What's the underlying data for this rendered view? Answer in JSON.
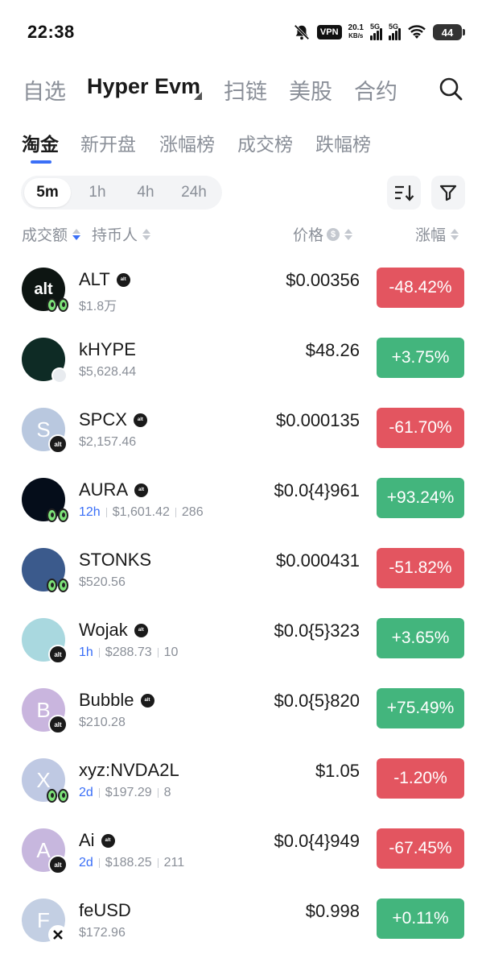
{
  "status_bar": {
    "time": "22:38",
    "vpn": "VPN",
    "net_speed_value": "20.1",
    "net_speed_unit": "KB/s",
    "signal1_label": "5G",
    "signal2_label": "5G",
    "battery": "44"
  },
  "top_nav": {
    "items": [
      "自选",
      "Hyper Evm",
      "扫链",
      "美股",
      "合约"
    ],
    "active_index": 1
  },
  "sub_tabs": {
    "items": [
      "淘金",
      "新开盘",
      "涨幅榜",
      "成交榜",
      "跌幅榜"
    ],
    "active_index": 0
  },
  "time_filter": {
    "options": [
      "5m",
      "1h",
      "4h",
      "24h"
    ],
    "selected": "5m"
  },
  "columns": {
    "volume": "成交额",
    "holders": "持币人",
    "price": "价格",
    "price_unit": "$",
    "change": "涨幅"
  },
  "tokens": [
    {
      "name": "ALT",
      "verified": true,
      "sub": "$1.8万",
      "age": "",
      "holders": "",
      "price": "$0.00356",
      "change": "-48.42%",
      "dir": "down",
      "avatar_letter": "alt",
      "avatar_color": "#0d1512",
      "badge": "eyes"
    },
    {
      "name": "kHYPE",
      "verified": false,
      "sub": "$5,628.44",
      "age": "",
      "holders": "",
      "price": "$48.26",
      "change": "+3.75%",
      "dir": "up",
      "avatar_letter": "",
      "avatar_color": "#0e2b25",
      "badge": "grey"
    },
    {
      "name": "SPCX",
      "verified": true,
      "sub": "$2,157.46",
      "age": "",
      "holders": "",
      "price": "$0.000135",
      "change": "-61.70%",
      "dir": "down",
      "avatar_letter": "S",
      "avatar_color": "#b9c8df",
      "badge": "alt"
    },
    {
      "name": "AURA",
      "verified": true,
      "sub": "$1,601.42",
      "age": "12h",
      "holders": "286",
      "price": "$0.0{4}961",
      "change": "+93.24%",
      "dir": "up",
      "avatar_letter": "",
      "avatar_color": "#050d1a",
      "badge": "eyes"
    },
    {
      "name": "STONKS",
      "verified": false,
      "sub": "$520.56",
      "age": "",
      "holders": "",
      "price": "$0.000431",
      "change": "-51.82%",
      "dir": "down",
      "avatar_letter": "",
      "avatar_color": "#3b5a8c",
      "badge": "eyes"
    },
    {
      "name": "Wojak",
      "verified": true,
      "sub": "$288.73",
      "age": "1h",
      "holders": "10",
      "price": "$0.0{5}323",
      "change": "+3.65%",
      "dir": "up",
      "avatar_letter": "",
      "avatar_color": "#a9d8df",
      "badge": "alt"
    },
    {
      "name": "Bubble",
      "verified": true,
      "sub": "$210.28",
      "age": "",
      "holders": "",
      "price": "$0.0{5}820",
      "change": "+75.49%",
      "dir": "up",
      "avatar_letter": "B",
      "avatar_color": "#c9b5de",
      "badge": "alt"
    },
    {
      "name": "xyz:NVDA2L",
      "verified": false,
      "sub": "$197.29",
      "age": "2d",
      "holders": "8",
      "price": "$1.05",
      "change": "-1.20%",
      "dir": "down",
      "avatar_letter": "X",
      "avatar_color": "#bfc9e3",
      "badge": "eyes"
    },
    {
      "name": "Ai",
      "verified": true,
      "sub": "$188.25",
      "age": "2d",
      "holders": "211",
      "price": "$0.0{4}949",
      "change": "-67.45%",
      "dir": "down",
      "avatar_letter": "A",
      "avatar_color": "#c7b7de",
      "badge": "alt"
    },
    {
      "name": "feUSD",
      "verified": false,
      "sub": "$172.96",
      "age": "",
      "holders": "",
      "price": "$0.998",
      "change": "+0.11%",
      "dir": "up",
      "avatar_letter": "F",
      "avatar_color": "#c3cfe3",
      "badge": "x"
    }
  ],
  "verified_badge_text": "alt",
  "colors": {
    "accent": "#3a6ff7",
    "up": "#43b57d",
    "down": "#e35560",
    "muted": "#8a8f98"
  }
}
